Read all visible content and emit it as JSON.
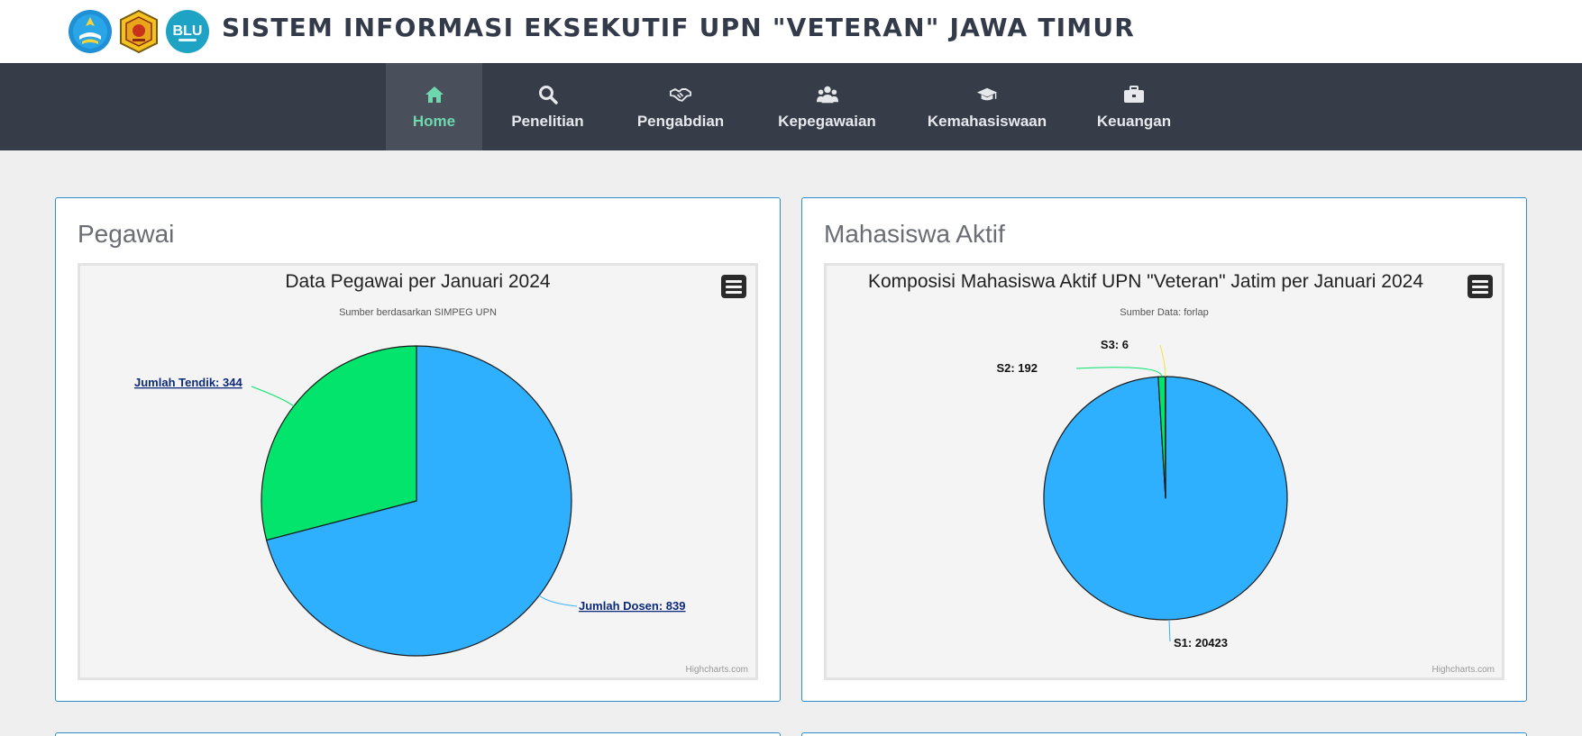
{
  "header": {
    "title": "SISTEM INFORMASI EKSEKUTIF UPN \"VETERAN\" JAWA TIMUR",
    "logos": [
      "tut-wuri-handayani-logo",
      "upn-veteran-logo",
      "blu-logo"
    ],
    "blu_text": "BLU"
  },
  "nav": {
    "items": [
      {
        "label": "Home",
        "icon": "home-icon",
        "active": true
      },
      {
        "label": "Penelitian",
        "icon": "search-icon"
      },
      {
        "label": "Pengabdian",
        "icon": "handshake-icon"
      },
      {
        "label": "Kepegawaian",
        "icon": "users-icon"
      },
      {
        "label": "Kemahasiswaan",
        "icon": "graduation-cap-icon"
      },
      {
        "label": "Keuangan",
        "icon": "briefcase-icon"
      }
    ]
  },
  "cards": [
    {
      "title": "Pegawai"
    },
    {
      "title": "Mahasiswa Aktif"
    }
  ],
  "colors": {
    "blue_slice": "#2fb0fe",
    "green_slice": "#02e46b",
    "nav_bg": "#363c48",
    "nav_active": "#6fd7ae",
    "card_border": "#2d8fd0"
  },
  "chart_data": [
    {
      "type": "pie",
      "title": "Data Pegawai per Januari 2024",
      "subtitle": "Sumber berdasarkan SIMPEG UPN",
      "credits": "Highcharts.com",
      "slices": [
        {
          "name": "Jumlah Dosen",
          "value": 839,
          "label": "Jumlah Dosen: 839",
          "color": "#2fb0fe"
        },
        {
          "name": "Jumlah Tendik",
          "value": 344,
          "label": "Jumlah Tendik: 344",
          "color": "#02e46b"
        }
      ]
    },
    {
      "type": "pie",
      "title": "Komposisi Mahasiswa Aktif UPN \"Veteran\" Jatim per Januari 2024",
      "subtitle": "Sumber Data: forlap",
      "credits": "Highcharts.com",
      "slices": [
        {
          "name": "S1",
          "value": 20423,
          "label": "S1: 20423",
          "color": "#2fb0fe"
        },
        {
          "name": "S2",
          "value": 192,
          "label": "S2: 192",
          "color": "#02e46b"
        },
        {
          "name": "S3",
          "value": 6,
          "label": "S3: 6",
          "color": "#f0e442"
        }
      ]
    }
  ]
}
